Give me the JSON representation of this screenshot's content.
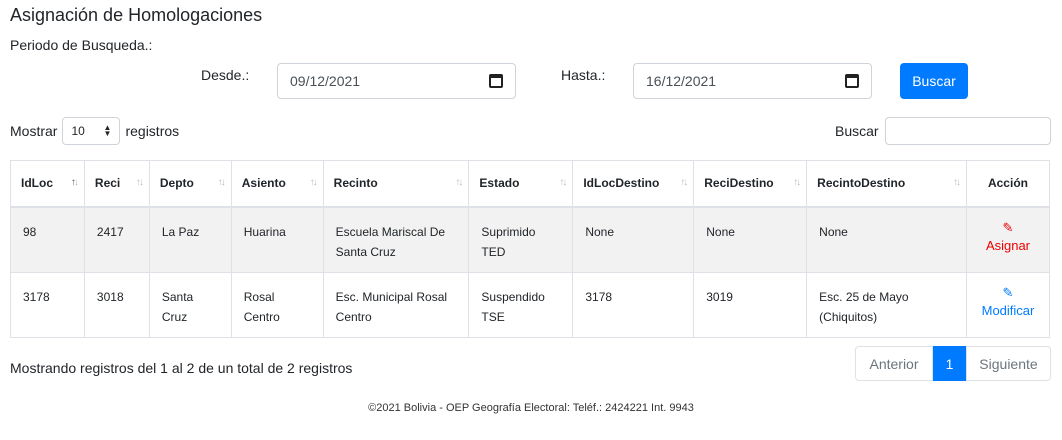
{
  "page": {
    "title": "Asignación de Homologaciones",
    "period_label": "Periodo de Busqueda.:"
  },
  "filters": {
    "desde_label": "Desde.:",
    "desde_value": "09/12/2021",
    "hasta_label": "Hasta.:",
    "hasta_value": "16/12/2021",
    "buscar_button": "Buscar",
    "calendar_icon": "calendar-icon"
  },
  "table_controls": {
    "show_prefix": "Mostrar",
    "show_value": "10",
    "show_suffix": "registros",
    "search_label": "Buscar"
  },
  "table": {
    "headers": [
      "IdLoc",
      "Reci",
      "Depto",
      "Asiento",
      "Recinto",
      "Estado",
      "IdLocDestino",
      "ReciDestino",
      "RecintoDestino",
      "Acción"
    ],
    "rows": [
      {
        "cells": [
          "98",
          "2417",
          "La Paz",
          "Huarina",
          "Escuela Mariscal De Santa Cruz",
          "Suprimido TED",
          "None",
          "None",
          "None"
        ],
        "action": "Asignar",
        "action_icon": "edit-icon",
        "action_color": "#e60000"
      },
      {
        "cells": [
          "3178",
          "3018",
          "Santa Cruz",
          "Rosal Centro",
          "Esc. Municipal Rosal Centro",
          "Suspendido TSE",
          "3178",
          "3019",
          "Esc. 25 de Mayo (Chiquitos)"
        ],
        "action": "Modificar",
        "action_icon": "edit-icon",
        "action_color": "#007bff"
      }
    ]
  },
  "pagination": {
    "info": "Mostrando registros del 1 al 2 de un total de 2 registros",
    "prev": "Anterior",
    "current": "1",
    "next": "Siguiente"
  },
  "footer": "©2021 Bolivia - OEP Geografía Electoral: Teléf.: 2424221 Int. 9943",
  "colors": {
    "primary": "#007bff",
    "danger": "#e60000"
  }
}
